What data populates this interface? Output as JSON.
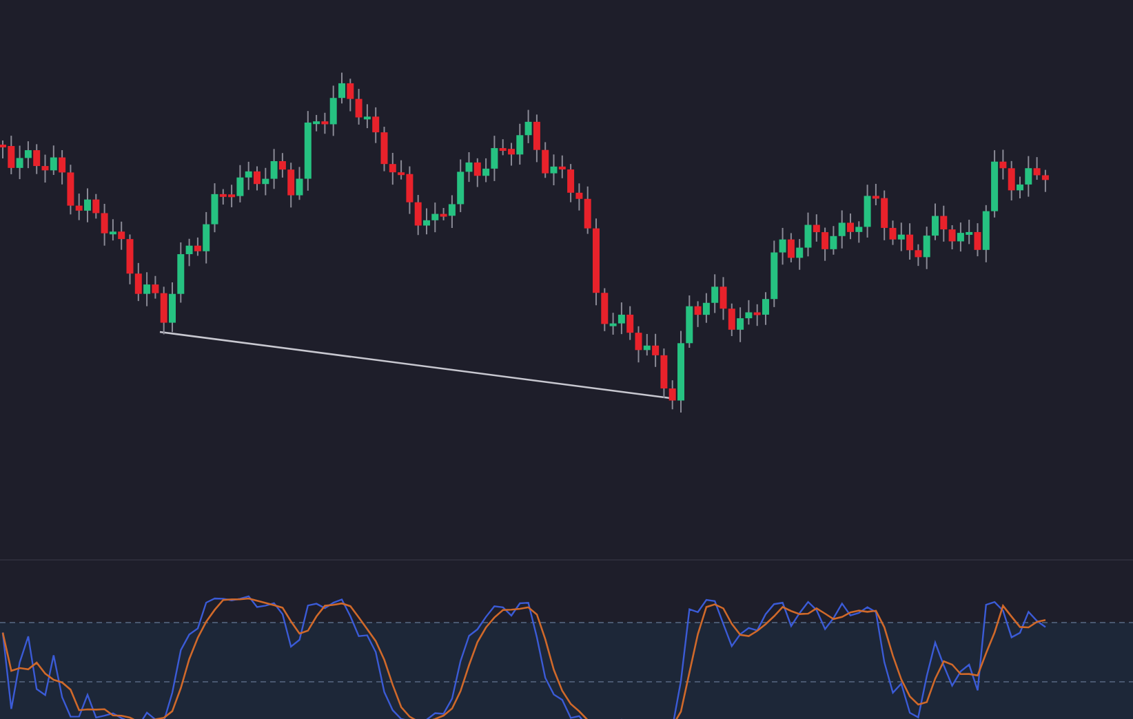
{
  "panels": [
    {
      "kind": "candlestick",
      "trend_line": true
    },
    {
      "kind": "oscillator",
      "band": true
    }
  ]
}
